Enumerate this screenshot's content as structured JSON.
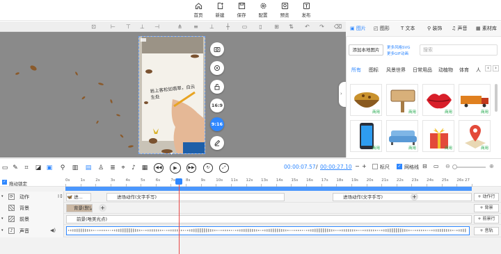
{
  "toolbar": {
    "home": "首页",
    "new": "新建",
    "save": "保存",
    "config": "配置",
    "preview": "预览",
    "publish": "发布"
  },
  "canvas": {
    "handwriting": "岩上客松如翡翠，白云生处",
    "ratio_169": "16:9",
    "ratio_916": "9:16"
  },
  "right_panel": {
    "tabs": [
      "图片",
      "图形",
      "文本",
      "装饰",
      "声音",
      "素材库"
    ],
    "add_local_label": "添加本地图片",
    "link_more_svg": "更多风格SVG",
    "link_more_gif": "更多GIF动画",
    "search_placeholder": "搜索",
    "categories": [
      "所有",
      "图标",
      "风景世界",
      "日常用品",
      "动植物",
      "体育",
      "人"
    ],
    "used_tag": "商用"
  },
  "timeline_controls": {
    "current_time": "00:00:07.57",
    "separator": "/",
    "total_time": "00:00:27.10",
    "minus": "−",
    "plus": "+",
    "ruler_label": "标尺",
    "grid_snap_label": "网格线"
  },
  "timeline": {
    "drag_lock_label": "拖动锁定",
    "ruler_ticks": [
      "0s",
      "1s",
      "2s",
      "3s",
      "4s",
      "5s",
      "6s",
      "7s",
      "8s",
      "9s",
      "10s",
      "11s",
      "12s",
      "13s",
      "14s",
      "15s",
      "16s",
      "17s",
      "18s",
      "19s",
      "20s",
      "21s",
      "22s",
      "23s",
      "24s",
      "25s",
      "26s",
      "27"
    ],
    "rows": [
      {
        "label": "动作",
        "clips": [
          "进...",
          "进场动作(文字手写)",
          "进场动作(文字手写)"
        ],
        "add_label": "+ 动作行"
      },
      {
        "label": "背景",
        "clips": [
          "背景(默认"
        ],
        "add_label": "+ 背景"
      },
      {
        "label": "前景",
        "clips": [
          "前景(唯美光点)"
        ],
        "add_label": "+ 前景行"
      },
      {
        "label": "声音",
        "clips": [
          ""
        ],
        "add_label": "+ 音轨"
      }
    ]
  },
  "colors": {
    "accent": "#2e87ff",
    "playhead": "#e84545",
    "commercial_tag": "#1fa84a"
  }
}
